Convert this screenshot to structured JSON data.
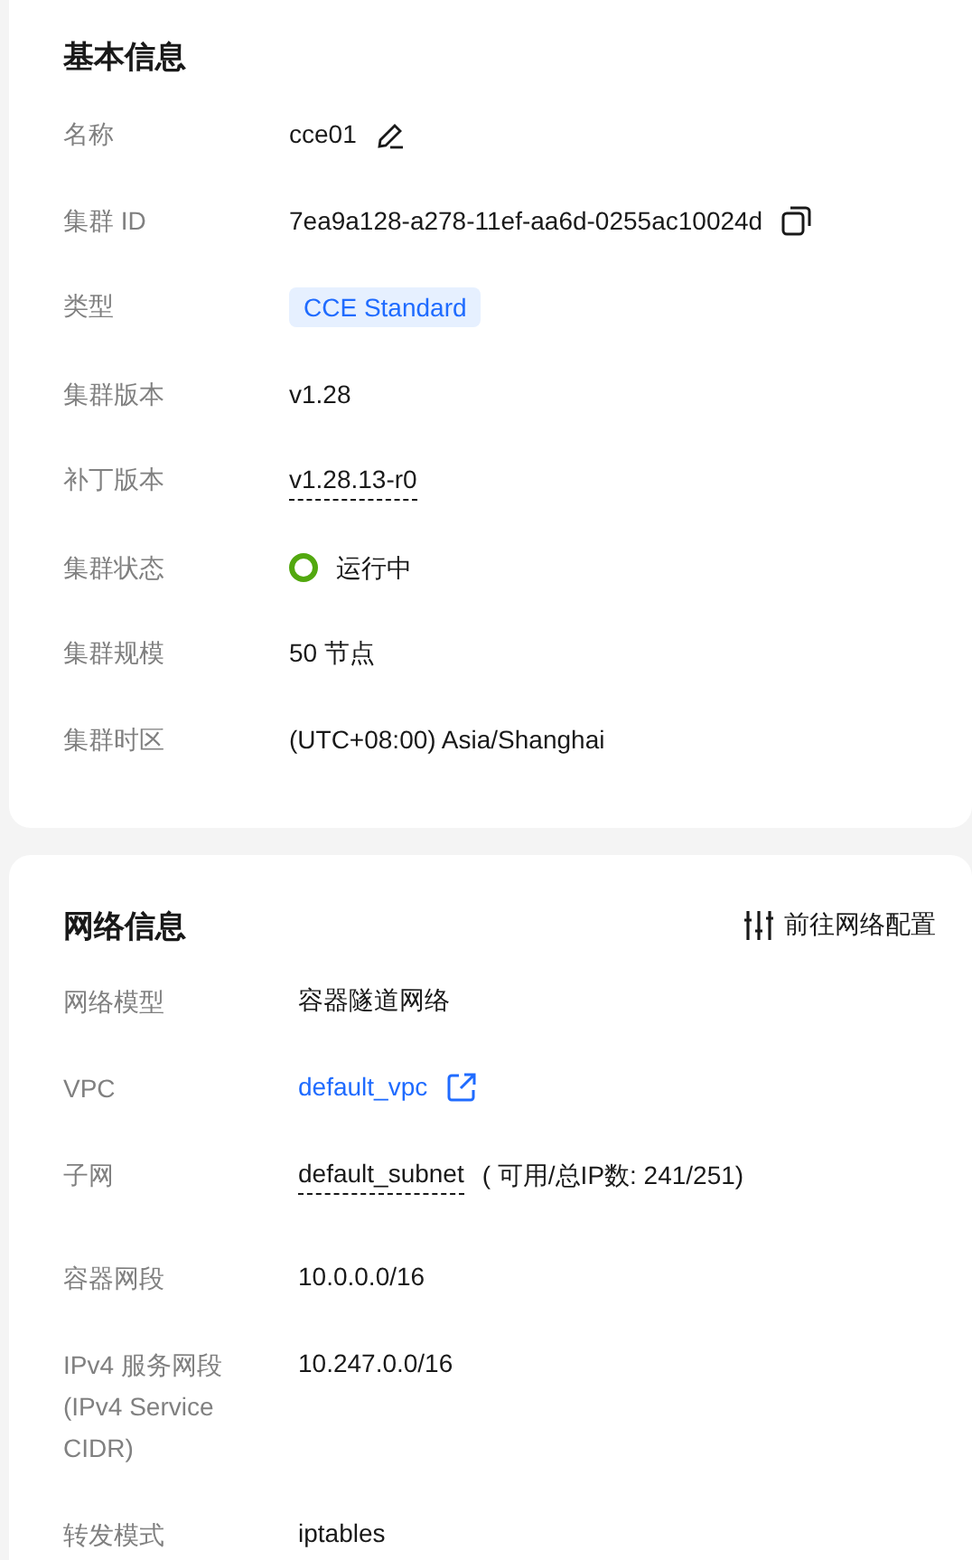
{
  "sections": [
    {
      "title": "基本信息",
      "rows": [
        {
          "label": "名称",
          "value": "cce01",
          "kind": "edit"
        },
        {
          "label": "集群 ID",
          "value": "7ea9a128-a278-11ef-aa6d-0255ac10024d",
          "kind": "copy"
        },
        {
          "label": "类型",
          "value": "CCE Standard",
          "kind": "tag"
        },
        {
          "label": "集群版本",
          "value": "v1.28",
          "kind": "text"
        },
        {
          "label": "补丁版本",
          "value": "v1.28.13-r0",
          "kind": "dashed"
        },
        {
          "label": "集群状态",
          "value": "运行中",
          "kind": "status"
        },
        {
          "label": "集群规模",
          "value": "50 节点",
          "kind": "text"
        },
        {
          "label": "集群时区",
          "value": "(UTC+08:00) Asia/Shanghai",
          "kind": "text"
        }
      ]
    },
    {
      "title": "网络信息",
      "action": "前往网络配置",
      "rows": [
        {
          "label": "网络模型",
          "value": "容器隧道网络",
          "kind": "text"
        },
        {
          "label": "VPC",
          "value": "default_vpc",
          "kind": "link"
        },
        {
          "label": "子网",
          "value": "default_subnet",
          "note": "( 可用/总IP数:  241/251)",
          "kind": "dashed"
        },
        {
          "label": "容器网段",
          "value": "10.0.0.0/16",
          "kind": "text"
        },
        {
          "label": "IPv4 服务网段 (IPv4 Service CIDR)",
          "value": "10.247.0.0/16",
          "kind": "text"
        },
        {
          "label": "转发模式",
          "value": "iptables",
          "kind": "text"
        }
      ]
    }
  ]
}
